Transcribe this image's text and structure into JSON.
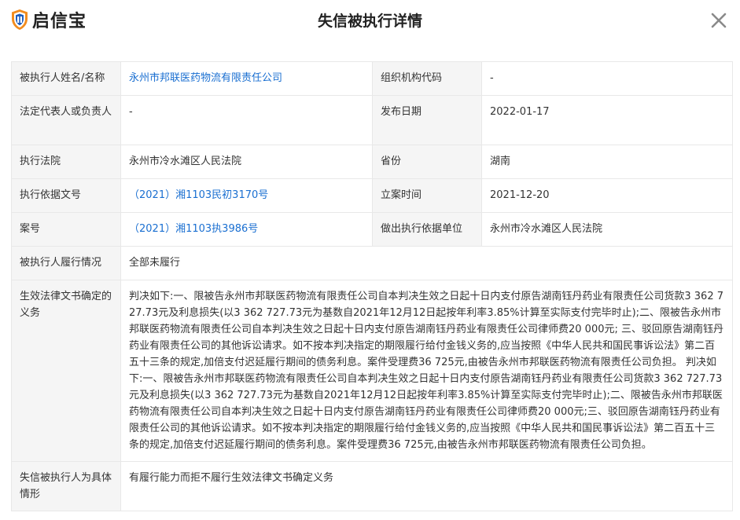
{
  "brand": {
    "name": "启信宝"
  },
  "page": {
    "title": "失信被执行详情"
  },
  "rows": {
    "debtor_name": {
      "label": "被执行人姓名/名称",
      "value": "永州市邦联医药物流有限责任公司"
    },
    "org_code": {
      "label": "组织机构代码",
      "value": "-"
    },
    "legal_rep": {
      "label": "法定代表人或负责人",
      "value": "-"
    },
    "publish_date": {
      "label": "发布日期",
      "value": "2022-01-17"
    },
    "court": {
      "label": "执行法院",
      "value": "永州市冷水滩区人民法院"
    },
    "province": {
      "label": "省份",
      "value": "湖南"
    },
    "basis_doc": {
      "label": "执行依据文号",
      "value": "（2021）湘1103民初3170号"
    },
    "filing_date": {
      "label": "立案时间",
      "value": "2021-12-20"
    },
    "case_no": {
      "label": "案号",
      "value": "（2021）湘1103执3986号"
    },
    "basis_unit": {
      "label": "做出执行依据单位",
      "value": "永州市冷水滩区人民法院"
    },
    "performance": {
      "label": "被执行人履行情况",
      "value": "全部未履行"
    },
    "obligation": {
      "label": "生效法律文书确定的义务",
      "value": "判决如下:一、限被告永州市邦联医药物流有限责任公司自本判决生效之日起十日内支付原告湖南钰丹药业有限责任公司货款3 362 727.73元及利息损失(以3 362 727.73元为基数自2021年12月12日起按年利率3.85%计算至实际支付完毕时止);二、限被告永州市邦联医药物流有限责任公司自本判决生效之日起十日内支付原告湖南钰丹药业有限责任公司律师费20 000元; 三、驳回原告湖南钰丹药业有限责任公司的其他诉讼请求。如不按本判决指定的期限履行给付金钱义务的,应当按照《中华人民共和国民事诉讼法》第二百五十三条的规定,加倍支付迟延履行期间的债务利息。案件受理费36 725元,由被告永州市邦联医药物流有限责任公司负担。 判决如下:一、限被告永州市邦联医药物流有限责任公司自本判决生效之日起十日内支付原告湖南钰丹药业有限责任公司货款3 362 727.73元及利息损失(以3 362 727.73元为基数自2021年12月12日起按年利率3.85%计算至实际支付完毕时止);二、限被告永州市邦联医药物流有限责任公司自本判决生效之日起十日内支付原告湖南钰丹药业有限责任公司律师费20 000元;三、驳回原告湖南钰丹药业有限责任公司的其他诉讼请求。如不按本判决指定的期限履行给付金钱义务的,应当按照《中华人民共和国民事诉讼法》第二百五十三条的规定,加倍支付迟延履行期间的债务利息。案件受理费36 725元,由被告永州市邦联医药物流有限责任公司负担。"
    },
    "circumstance": {
      "label": "失信被执行人为具体情形",
      "value": "有履行能力而拒不履行生效法律文书确定义务"
    }
  },
  "icons": {
    "logo": "shield-logo-icon",
    "close": "close-icon"
  },
  "colors": {
    "link": "#1a6fd1",
    "label_bg": "#f5f5f5",
    "border": "#e8e8e8",
    "logo_orange": "#f28c1e",
    "logo_blue": "#1f5fbf"
  }
}
